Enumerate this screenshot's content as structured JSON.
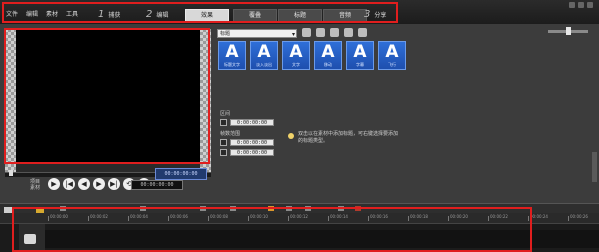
{
  "menu": [
    "文件",
    "编辑",
    "素材",
    "工具"
  ],
  "steps": [
    {
      "num": "1",
      "label": "捕获"
    },
    {
      "num": "2",
      "label": "编辑"
    },
    {
      "num": "3",
      "label": "分享"
    }
  ],
  "tabs": [
    {
      "label": "效果",
      "active": true
    },
    {
      "label": "覆叠",
      "active": false
    },
    {
      "label": "标题",
      "active": false
    },
    {
      "label": "音频",
      "active": false
    }
  ],
  "player": {
    "play_label": "项目\n素材",
    "controls": [
      "▶",
      "|◀",
      "◀",
      "▶",
      "▶|",
      "⟲",
      "▶|"
    ],
    "timecode_small": "00:00:00:00",
    "timecode_blue": "00:00:00:00"
  },
  "library": {
    "dropdown": "标题",
    "thumbnails": [
      "标题文字",
      "淡入淡出",
      "文字",
      "移动",
      "字幕",
      "飞行"
    ],
    "duration_label": "区间",
    "duration_value": "0:00:00:00",
    "frame_label": "帧数范围",
    "start_value": "0:00:00:00",
    "end_value": "0:00:00:00",
    "hint_text": "双击以在素材中添加标题，可右键选择要添加的标题类型。"
  },
  "timeline": {
    "ruler_times": [
      "00:00:00",
      "00:00:02",
      "00:00:04",
      "00:00:06",
      "00:00:08",
      "00:00:10",
      "00:00:12",
      "00:00:14",
      "00:00:16",
      "00:00:18",
      "00:00:20",
      "00:00:22",
      "00:00:24",
      "00:00:26"
    ]
  },
  "colors": {
    "highlight": "#e01e1e",
    "thumb": "#2f6fd8",
    "timecode_bg": "#213a6e"
  }
}
